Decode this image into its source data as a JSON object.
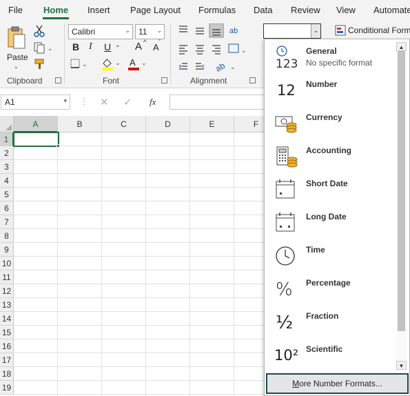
{
  "tabs": [
    "File",
    "Home",
    "Insert",
    "Page Layout",
    "Formulas",
    "Data",
    "Review",
    "View",
    "Automate"
  ],
  "ribbon": {
    "clipboard": {
      "label": "Clipboard",
      "paste_label": "Paste"
    },
    "font": {
      "label": "Font",
      "font_name": "Calibri",
      "font_size": "11",
      "bold": "B",
      "italic": "I",
      "underline": "U",
      "grow": "A",
      "shrink": "A"
    },
    "alignment": {
      "label": "Alignment"
    },
    "number": {
      "format_value": ""
    },
    "styles": {
      "conditional_label": "Conditional Form"
    }
  },
  "formula_bar": {
    "name_box": "A1",
    "fx": "fx",
    "formula": ""
  },
  "sheet": {
    "columns": [
      "A",
      "B",
      "C",
      "D",
      "E",
      "F"
    ],
    "rows": [
      "1",
      "2",
      "3",
      "4",
      "5",
      "6",
      "7",
      "8",
      "9",
      "10",
      "11",
      "12",
      "13",
      "14",
      "15",
      "16",
      "17",
      "18",
      "19"
    ],
    "active_cell": "A1"
  },
  "number_format_menu": {
    "items": [
      {
        "icon": "clock-123-icon",
        "title": "General",
        "subtitle": "No specific format",
        "glyph": "123"
      },
      {
        "icon": "number-12-icon",
        "title": "Number",
        "subtitle": "",
        "glyph": "12"
      },
      {
        "icon": "currency-icon",
        "title": "Currency",
        "subtitle": "",
        "glyph": ""
      },
      {
        "icon": "accounting-icon",
        "title": "Accounting",
        "subtitle": "",
        "glyph": ""
      },
      {
        "icon": "calendar-short-icon",
        "title": "Short Date",
        "subtitle": "",
        "glyph": ""
      },
      {
        "icon": "calendar-long-icon",
        "title": "Long Date",
        "subtitle": "",
        "glyph": ""
      },
      {
        "icon": "clock-icon",
        "title": "Time",
        "subtitle": "",
        "glyph": ""
      },
      {
        "icon": "percent-icon",
        "title": "Percentage",
        "subtitle": "",
        "glyph": "%"
      },
      {
        "icon": "fraction-icon",
        "title": "Fraction",
        "subtitle": "",
        "glyph": "½"
      },
      {
        "icon": "scientific-icon",
        "title": "Scientific",
        "subtitle": "",
        "glyph": "10²"
      }
    ],
    "more_label_underlined": "M",
    "more_label_rest": "ore Number Formats..."
  },
  "colors": {
    "accent": "#1e6f41",
    "highlight_yellow": "#ffff00",
    "font_red": "#e00000"
  }
}
